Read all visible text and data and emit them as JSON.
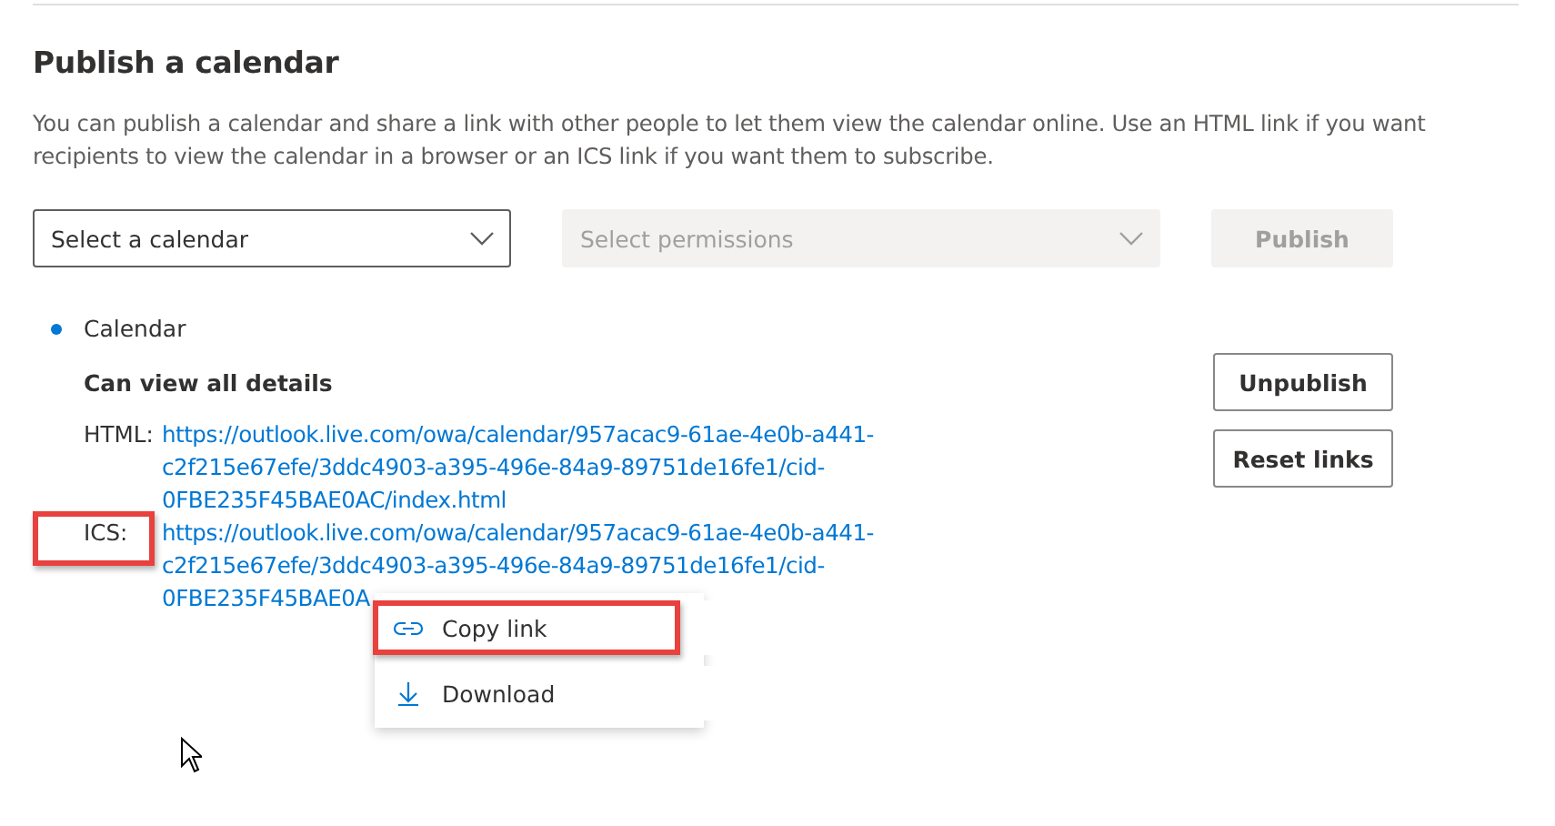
{
  "section": {
    "title": "Publish a calendar",
    "description": "You can publish a calendar and share a link with other people to let them view the calendar online. Use an HTML link if you want recipients to view the calendar in a browser or an ICS link if you want them to subscribe."
  },
  "controls": {
    "calendar_select": {
      "placeholder": "Select a calendar",
      "disabled": false
    },
    "permissions_select": {
      "placeholder": "Select permissions",
      "disabled": true
    },
    "publish_button": {
      "label": "Publish",
      "disabled": true
    }
  },
  "published": {
    "calendar": "Calendar",
    "permission": "Can view all details",
    "links": [
      {
        "label": "HTML:",
        "lines": [
          "https://outlook.live.com/owa/calendar/957acac9-61ae-4e0b-a441-",
          "c2f215e67efe/3ddc4903-a395-496e-84a9-89751de16fe1/cid-",
          "0FBE235F45BAE0AC/index.html"
        ],
        "highlighted": false
      },
      {
        "label": "ICS:",
        "lines": [
          "https://outlook.live.com/owa/calendar/957acac9-61ae-4e0b-a441-",
          "c2f215e67efe/3ddc4903-a395-496e-84a9-89751de16fe1/cid-",
          "0FBE235F45BAE0A"
        ],
        "highlighted": true
      }
    ],
    "buttons": [
      "Unpublish",
      "Reset links"
    ]
  },
  "context_menu": {
    "items": [
      {
        "kind": "link",
        "label": "Copy link",
        "highlighted": true
      },
      {
        "kind": "download",
        "label": "Download",
        "highlighted": false
      }
    ]
  }
}
